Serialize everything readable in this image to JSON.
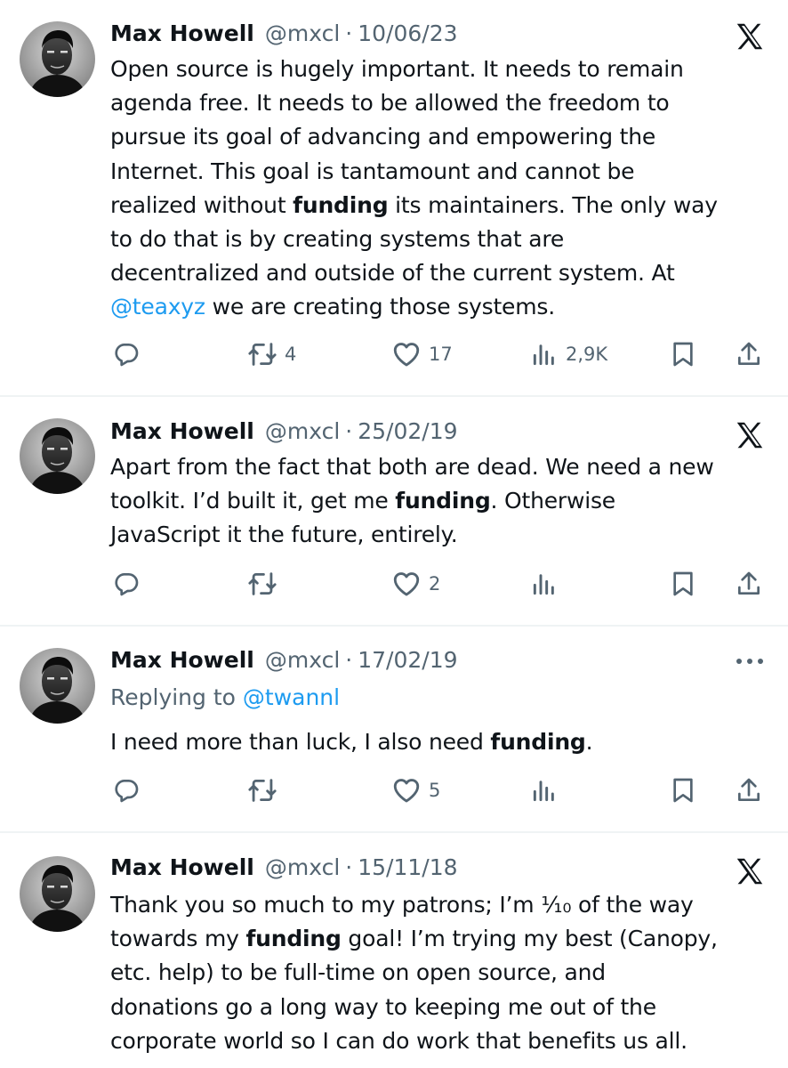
{
  "tweets": [
    {
      "name": "Max Howell",
      "handle": "@mxcl",
      "separator": "·",
      "date": "10/06/23",
      "corner_icon": "x-logo-icon",
      "lines": [
        [
          "Open source is hugely important. It needs to remain"
        ],
        [
          "agenda free. It needs to be allowed the freedom to"
        ],
        [
          "pursue its goal of advancing and empowering the"
        ],
        [
          "Internet. This goal is tantamount and cannot be"
        ],
        [
          "realized without ",
          "funding",
          " its maintainers. The only way"
        ],
        [
          "to do that is by creating systems that are"
        ],
        [
          "decentralized and outside of the current system. At"
        ],
        [
          "@teaxyz",
          " we are creating those systems."
        ]
      ],
      "actions": {
        "reply_count": "",
        "retweet_count": "4",
        "like_count": "17",
        "views_count": "2,9K"
      }
    },
    {
      "name": "Max Howell",
      "handle": "@mxcl",
      "separator": "·",
      "date": "25/02/19",
      "corner_icon": "x-logo-icon",
      "lines": [
        [
          "Apart from the fact that both are dead. We need a new"
        ],
        [
          "toolkit. I’d built it, get me ",
          "funding",
          ". Otherwise"
        ],
        [
          "JavaScript it the future, entirely."
        ]
      ],
      "actions": {
        "reply_count": "",
        "retweet_count": "",
        "like_count": "2",
        "views_count": ""
      }
    },
    {
      "name": "Max Howell",
      "handle": "@mxcl",
      "separator": "·",
      "date": "17/02/19",
      "corner_icon": "more-icon",
      "replying_prefix": "Replying to ",
      "replying_to": "@twannl",
      "lines": [
        [
          "I need more than luck, I also need ",
          "funding",
          "."
        ]
      ],
      "actions": {
        "reply_count": "",
        "retweet_count": "",
        "like_count": "5",
        "views_count": ""
      }
    },
    {
      "name": "Max Howell",
      "handle": "@mxcl",
      "separator": "·",
      "date": "15/11/18",
      "corner_icon": "x-logo-icon",
      "lines": [
        [
          "Thank you so much to my patrons; I’m ⅒ of the way"
        ],
        [
          "towards my ",
          "funding",
          " goal! I’m trying my best (Canopy,"
        ],
        [
          "etc. help) to be full-time on open source, and"
        ],
        [
          "donations go a long way to keeping me out of the"
        ],
        [
          "corporate world so I can do work that benefits us all."
        ]
      ]
    }
  ],
  "colors": {
    "text": "#0f1419",
    "secondary": "#536471",
    "link": "#1d9bf0",
    "divider": "#eff3f4"
  },
  "icons": [
    "reply-icon",
    "retweet-icon",
    "like-icon",
    "views-icon",
    "bookmark-icon",
    "share-icon",
    "x-logo-icon",
    "more-icon"
  ]
}
